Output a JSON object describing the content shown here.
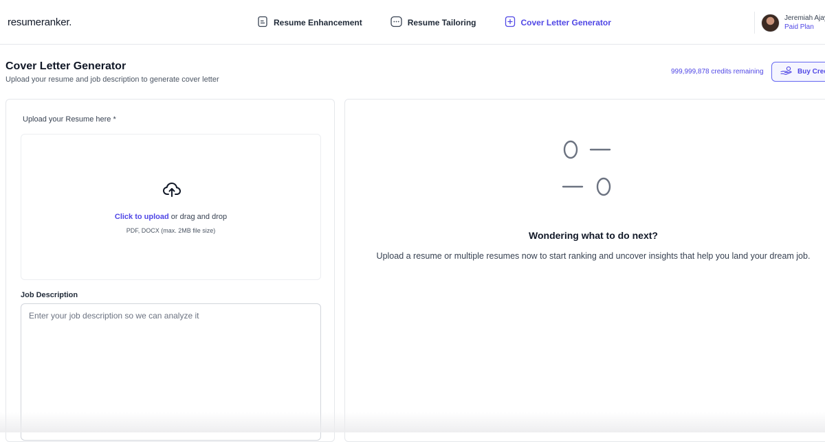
{
  "app": {
    "logo": "resumeranker."
  },
  "nav": {
    "items": [
      {
        "label": "Resume Enhancement",
        "icon": "document-icon",
        "active": false
      },
      {
        "label": "Resume Tailoring",
        "icon": "ellipsis-icon",
        "active": false
      },
      {
        "label": "Cover Letter Generator",
        "icon": "add-document-icon",
        "active": true
      }
    ]
  },
  "user": {
    "name": "Jeremiah Ajay",
    "plan": "Paid Plan"
  },
  "page": {
    "title": "Cover Letter Generator",
    "subtitle": "Upload your resume and job description to generate cover letter"
  },
  "credits": {
    "text": "999,999,878 credits remaining"
  },
  "buy_button": {
    "label": "Buy Credits",
    "icon": "coins-hand-icon"
  },
  "upload": {
    "label": "Upload your Resume here *",
    "link": "Click to upload",
    "rest": " or drag and drop",
    "hint": "PDF, DOCX (max. 2MB file size)",
    "icon": "cloud-upload-icon"
  },
  "job_description": {
    "label": "Job Description",
    "placeholder": "Enter your job description so we can analyze it",
    "value": ""
  },
  "empty_state": {
    "icon": "toggle-lines-icon",
    "title": "Wondering what to do next?",
    "body": "Upload a resume or multiple resumes now to start ranking and uncover insights that help you land your dream job."
  },
  "colors": {
    "accent": "#4f46e5",
    "border": "#e5e7eb",
    "icon_gray": "#6b7280"
  }
}
